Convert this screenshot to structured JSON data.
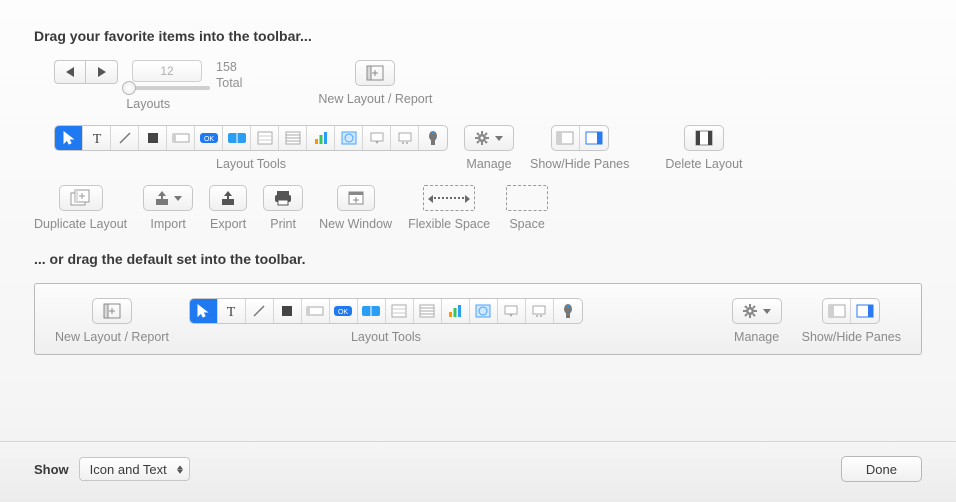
{
  "headings": {
    "drag_in": "Drag your favorite items into the toolbar...",
    "default_set": "... or drag the default set into the toolbar."
  },
  "layouts": {
    "current": "12",
    "total": "158",
    "total_suffix": "Total",
    "label": "Layouts"
  },
  "items": {
    "new_layout": "New Layout / Report",
    "layout_tools": "Layout Tools",
    "manage": "Manage",
    "show_hide_panes": "Show/Hide Panes",
    "delete_layout": "Delete Layout",
    "duplicate_layout": "Duplicate Layout",
    "import": "Import",
    "export": "Export",
    "print": "Print",
    "new_window": "New Window",
    "flexible_space": "Flexible Space",
    "space": "Space"
  },
  "footer": {
    "show_label": "Show",
    "show_value": "Icon and Text",
    "done": "Done"
  }
}
